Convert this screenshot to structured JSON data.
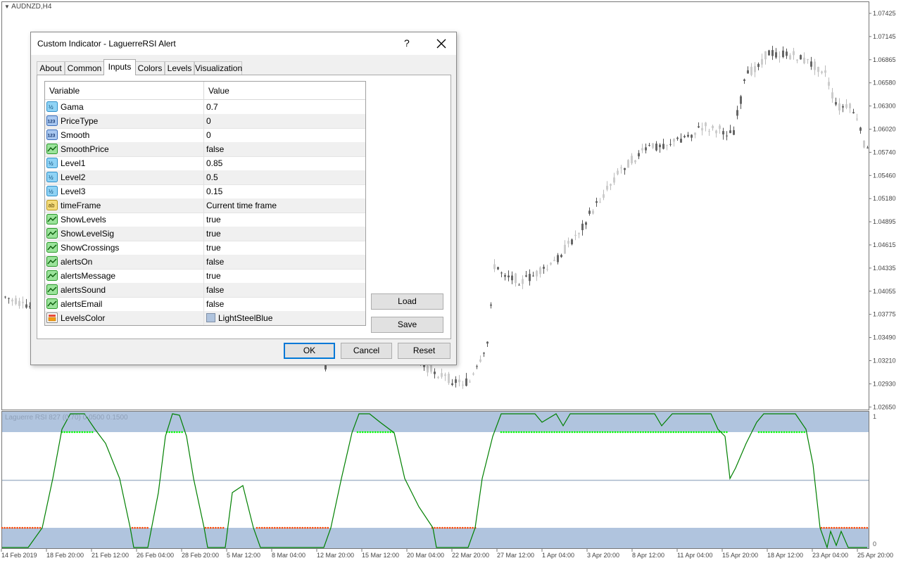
{
  "chart": {
    "symbol": "AUDNZD,H4",
    "indicator_label": "Laguerre RSI 827 (0.70) 0.0500 0.1500",
    "price_labels": [
      "1.07425",
      "1.07145",
      "1.06865",
      "1.06580",
      "1.06300",
      "1.06020",
      "1.05740",
      "1.05460",
      "1.05180",
      "1.04895",
      "1.04615",
      "1.04335",
      "1.04055",
      "1.03775",
      "1.03490",
      "1.03210",
      "1.02930",
      "1.02650"
    ],
    "ind_scale": [
      "1",
      "0"
    ],
    "time_labels": [
      "14 Feb 2019",
      "18 Feb 20:00",
      "21 Feb 12:00",
      "26 Feb 04:00",
      "28 Feb 20:00",
      "5 Mar 12:00",
      "8 Mar 04:00",
      "12 Mar 20:00",
      "15 Mar 12:00",
      "20 Mar 04:00",
      "22 Mar 20:00",
      "27 Mar 12:00",
      "1 Apr 04:00",
      "3 Apr 20:00",
      "8 Apr 12:00",
      "11 Apr 04:00",
      "15 Apr 20:00",
      "18 Apr 12:00",
      "23 Apr 04:00",
      "25 Apr 20:00"
    ],
    "colors": {
      "band": "#b0c4de",
      "rsi_line": "#008000",
      "dots_up": "#00ff00",
      "dots_dn": "#ff4500",
      "mid_line": "#a8b8cc"
    }
  },
  "dialog": {
    "title": "Custom Indicator - LaguerreRSI Alert",
    "help_label": "?",
    "tabs": [
      "About",
      "Common",
      "Inputs",
      "Colors",
      "Levels",
      "Visualization"
    ],
    "active_tab": "Inputs",
    "columns": {
      "variable": "Variable",
      "value": "Value"
    },
    "rows": [
      {
        "icon": "double-icon",
        "variable": "Gama",
        "value": "0.7"
      },
      {
        "icon": "integer-icon",
        "variable": "PriceType",
        "value": "0"
      },
      {
        "icon": "integer-icon",
        "variable": "Smooth",
        "value": "0"
      },
      {
        "icon": "bool-icon",
        "variable": "SmoothPrice",
        "value": "false"
      },
      {
        "icon": "double-icon",
        "variable": "Level1",
        "value": "0.85"
      },
      {
        "icon": "double-icon",
        "variable": "Level2",
        "value": "0.5"
      },
      {
        "icon": "double-icon",
        "variable": "Level3",
        "value": "0.15"
      },
      {
        "icon": "string-icon",
        "variable": "timeFrame",
        "value": "Current time frame"
      },
      {
        "icon": "bool-icon",
        "variable": "ShowLevels",
        "value": "true"
      },
      {
        "icon": "bool-icon",
        "variable": "ShowLevelSig",
        "value": "true"
      },
      {
        "icon": "bool-icon",
        "variable": "ShowCrossings",
        "value": "true"
      },
      {
        "icon": "bool-icon",
        "variable": "alertsOn",
        "value": "false"
      },
      {
        "icon": "bool-icon",
        "variable": "alertsMessage",
        "value": "true"
      },
      {
        "icon": "bool-icon",
        "variable": "alertsSound",
        "value": "false"
      },
      {
        "icon": "bool-icon",
        "variable": "alertsEmail",
        "value": "false"
      },
      {
        "icon": "color-icon",
        "variable": "LevelsColor",
        "value": "LightSteelBlue"
      }
    ],
    "buttons": {
      "load": "Load",
      "save": "Save",
      "ok": "OK",
      "cancel": "Cancel",
      "reset": "Reset"
    }
  }
}
